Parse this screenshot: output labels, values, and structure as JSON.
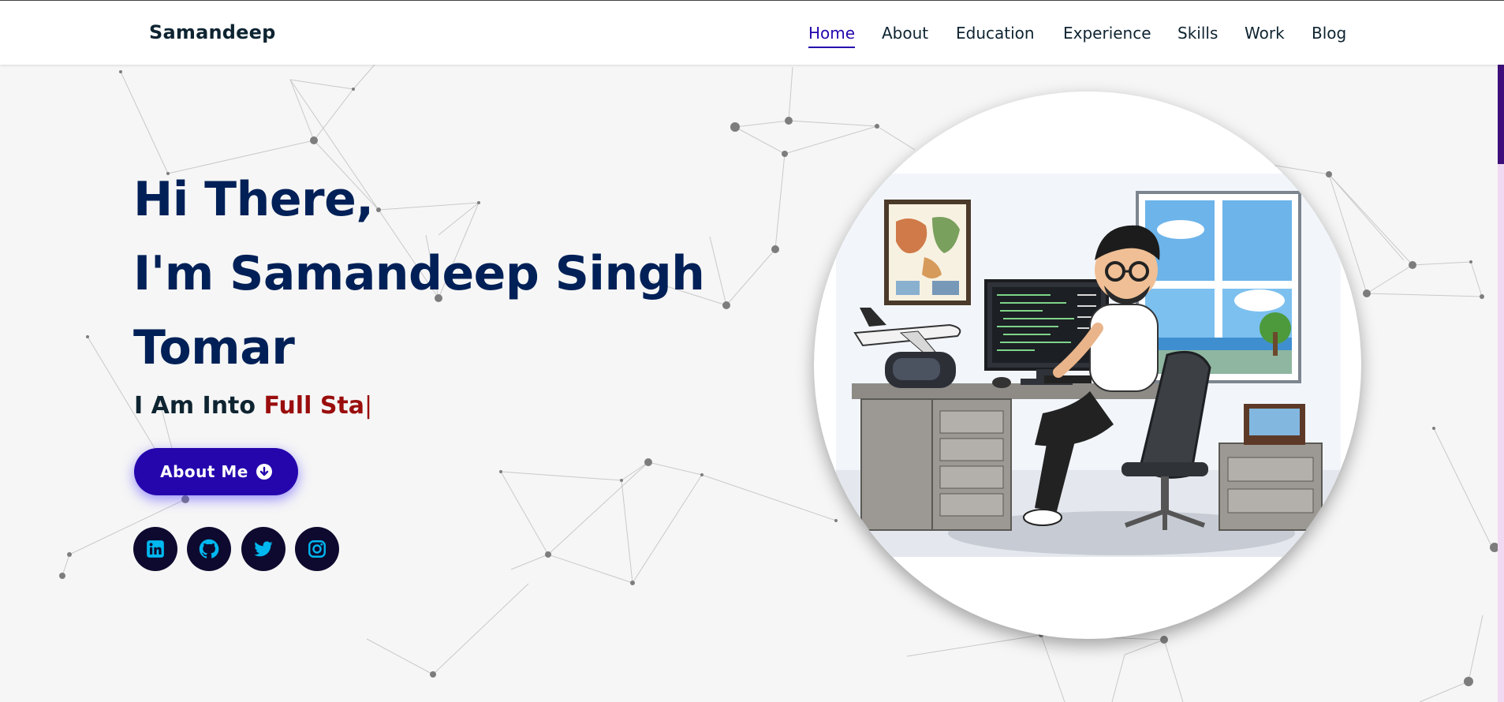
{
  "brand": {
    "name": "Samandeep"
  },
  "nav": {
    "items": [
      "Home",
      "About",
      "Education",
      "Experience",
      "Skills",
      "Work",
      "Blog"
    ],
    "active": "Home"
  },
  "hero": {
    "greeting": "Hi There,",
    "name_line1": "I'm Samandeep Singh",
    "name_line2": "Tomar",
    "typed_prefix": "I Am Into",
    "typed_text": "Full Sta",
    "caret": "|"
  },
  "about_button": {
    "label": "About Me",
    "icon": "arrow-circle-down-icon"
  },
  "social": [
    {
      "name": "linkedin",
      "icon": "linkedin-icon"
    },
    {
      "name": "github",
      "icon": "github-icon"
    },
    {
      "name": "twitter",
      "icon": "twitter-icon"
    },
    {
      "name": "instagram",
      "icon": "instagram-icon"
    }
  ],
  "colors": {
    "primary": "#2506ad",
    "heading": "#002057",
    "accent_text": "#9a0d0d",
    "social_bg": "#0e0a2f",
    "social_icon": "#00b8f0",
    "background": "#f6f6f6"
  }
}
